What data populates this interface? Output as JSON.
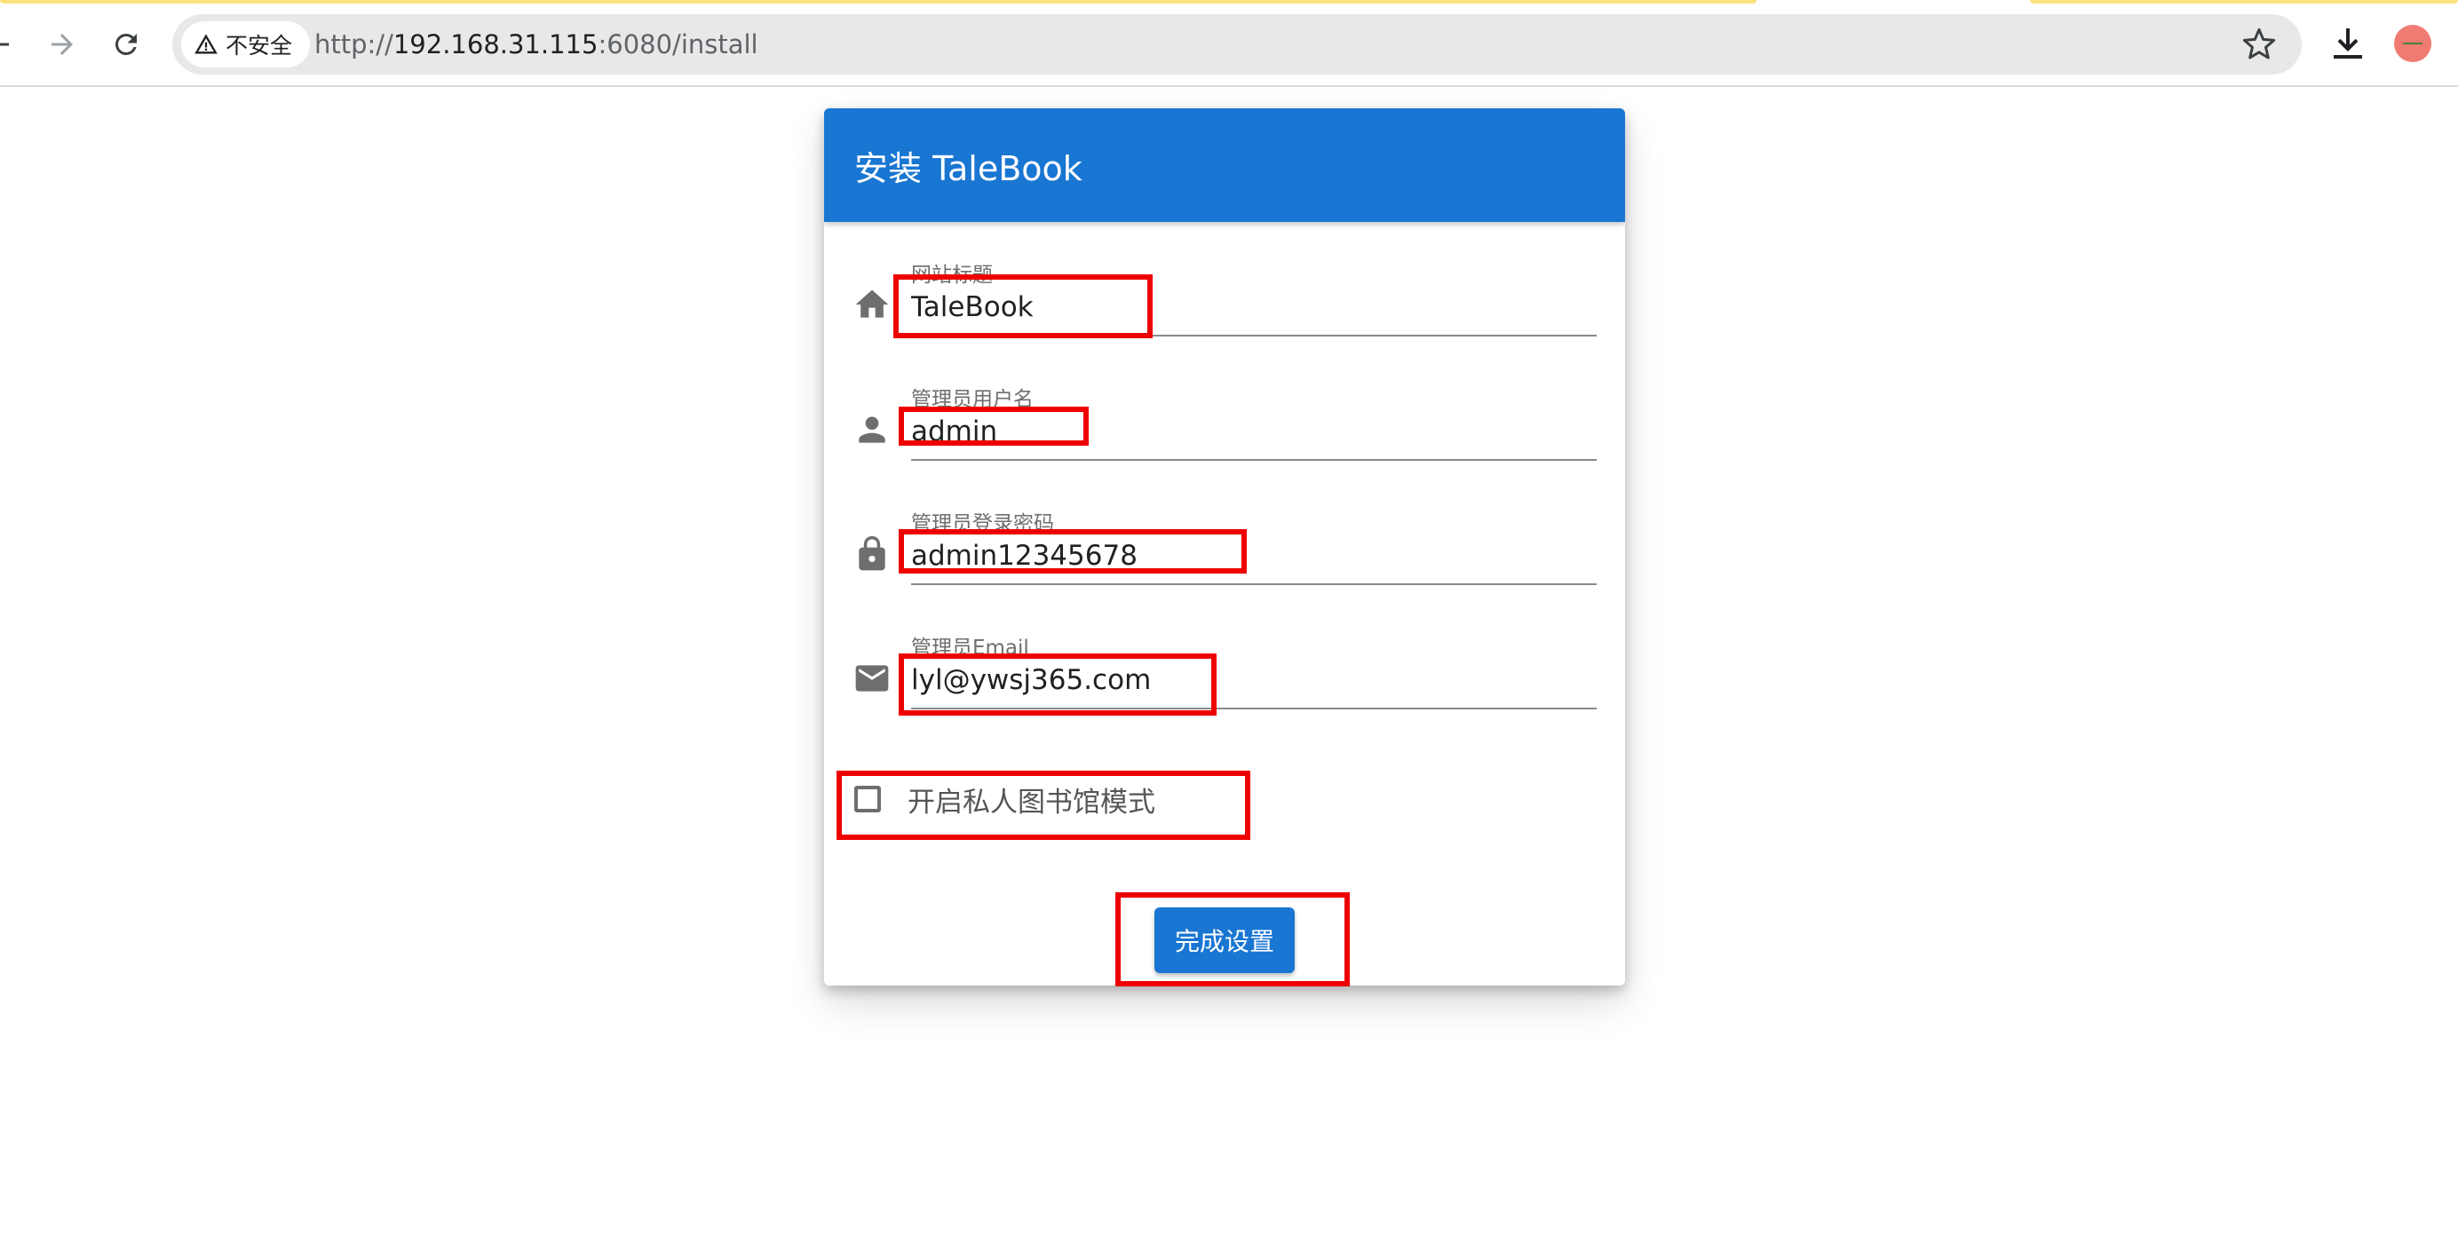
{
  "browser": {
    "security_label": "不安全",
    "url_scheme": "http://",
    "url_host": "192.168.31.115",
    "url_rest": ":6080/install"
  },
  "card": {
    "title": "安装 TaleBook",
    "fields": [
      {
        "label": "网站标题",
        "value": "TaleBook",
        "icon": "home-icon"
      },
      {
        "label": "管理员用户名",
        "value": "admin",
        "icon": "person-icon"
      },
      {
        "label": "管理员登录密码",
        "value": "admin12345678",
        "icon": "lock-icon"
      },
      {
        "label": "管理员Email",
        "value": "lyl@ywsj365.com",
        "icon": "mail-icon"
      }
    ],
    "private_mode_label": "开启私人图书馆模式",
    "private_mode_checked": false,
    "submit_label": "完成设置"
  },
  "colors": {
    "primary": "#1976d2",
    "annotation": "#ee0000",
    "tab_accent": "#fbe27a"
  }
}
